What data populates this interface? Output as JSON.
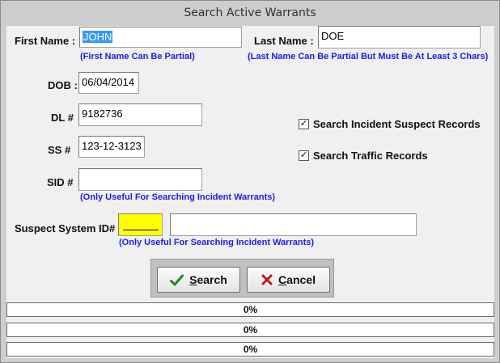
{
  "window": {
    "title": "Search Active Warrants"
  },
  "form": {
    "first_name": {
      "label": "First Name :",
      "value_selected": "JOHN",
      "hint": "(First Name Can Be Partial)"
    },
    "last_name": {
      "label": "Last Name :",
      "value": "DOE",
      "hint": "(Last Name Can Be Partial But Must Be At Least 3 Chars)"
    },
    "dob": {
      "label": "DOB :",
      "value": "06/04/2014"
    },
    "dl": {
      "label": "DL #",
      "value": "9182736"
    },
    "ss": {
      "label": "SS #",
      "value": "123-12-3123"
    },
    "sid": {
      "label": "SID #",
      "value": "",
      "hint": "(Only Useful For Searching Incident Warrants)"
    },
    "suspect_system_id": {
      "label": "Suspect System ID#",
      "value": "",
      "hint": "(Only Useful For Searching Incident Warrants)"
    }
  },
  "options": {
    "incident_suspect": {
      "label": "Search Incident Suspect Records",
      "checked": true
    },
    "traffic": {
      "label": "Search Traffic Records",
      "checked": true
    }
  },
  "buttons": {
    "search": {
      "mnemonic": "S",
      "rest": "earch",
      "icon": "checkmark-icon"
    },
    "cancel": {
      "mnemonic": "C",
      "rest": "ancel",
      "icon": "x-icon"
    }
  },
  "progress_bars": [
    {
      "text": "0%",
      "value": 0
    },
    {
      "text": "0%",
      "value": 0
    },
    {
      "text": "0%",
      "value": 0
    }
  ],
  "colors": {
    "hint": "#1a1aff",
    "highlight_field": "#ffff00",
    "selection": "#3399ff",
    "search_icon": "#1f8a1f",
    "cancel_icon": "#c0151b"
  }
}
